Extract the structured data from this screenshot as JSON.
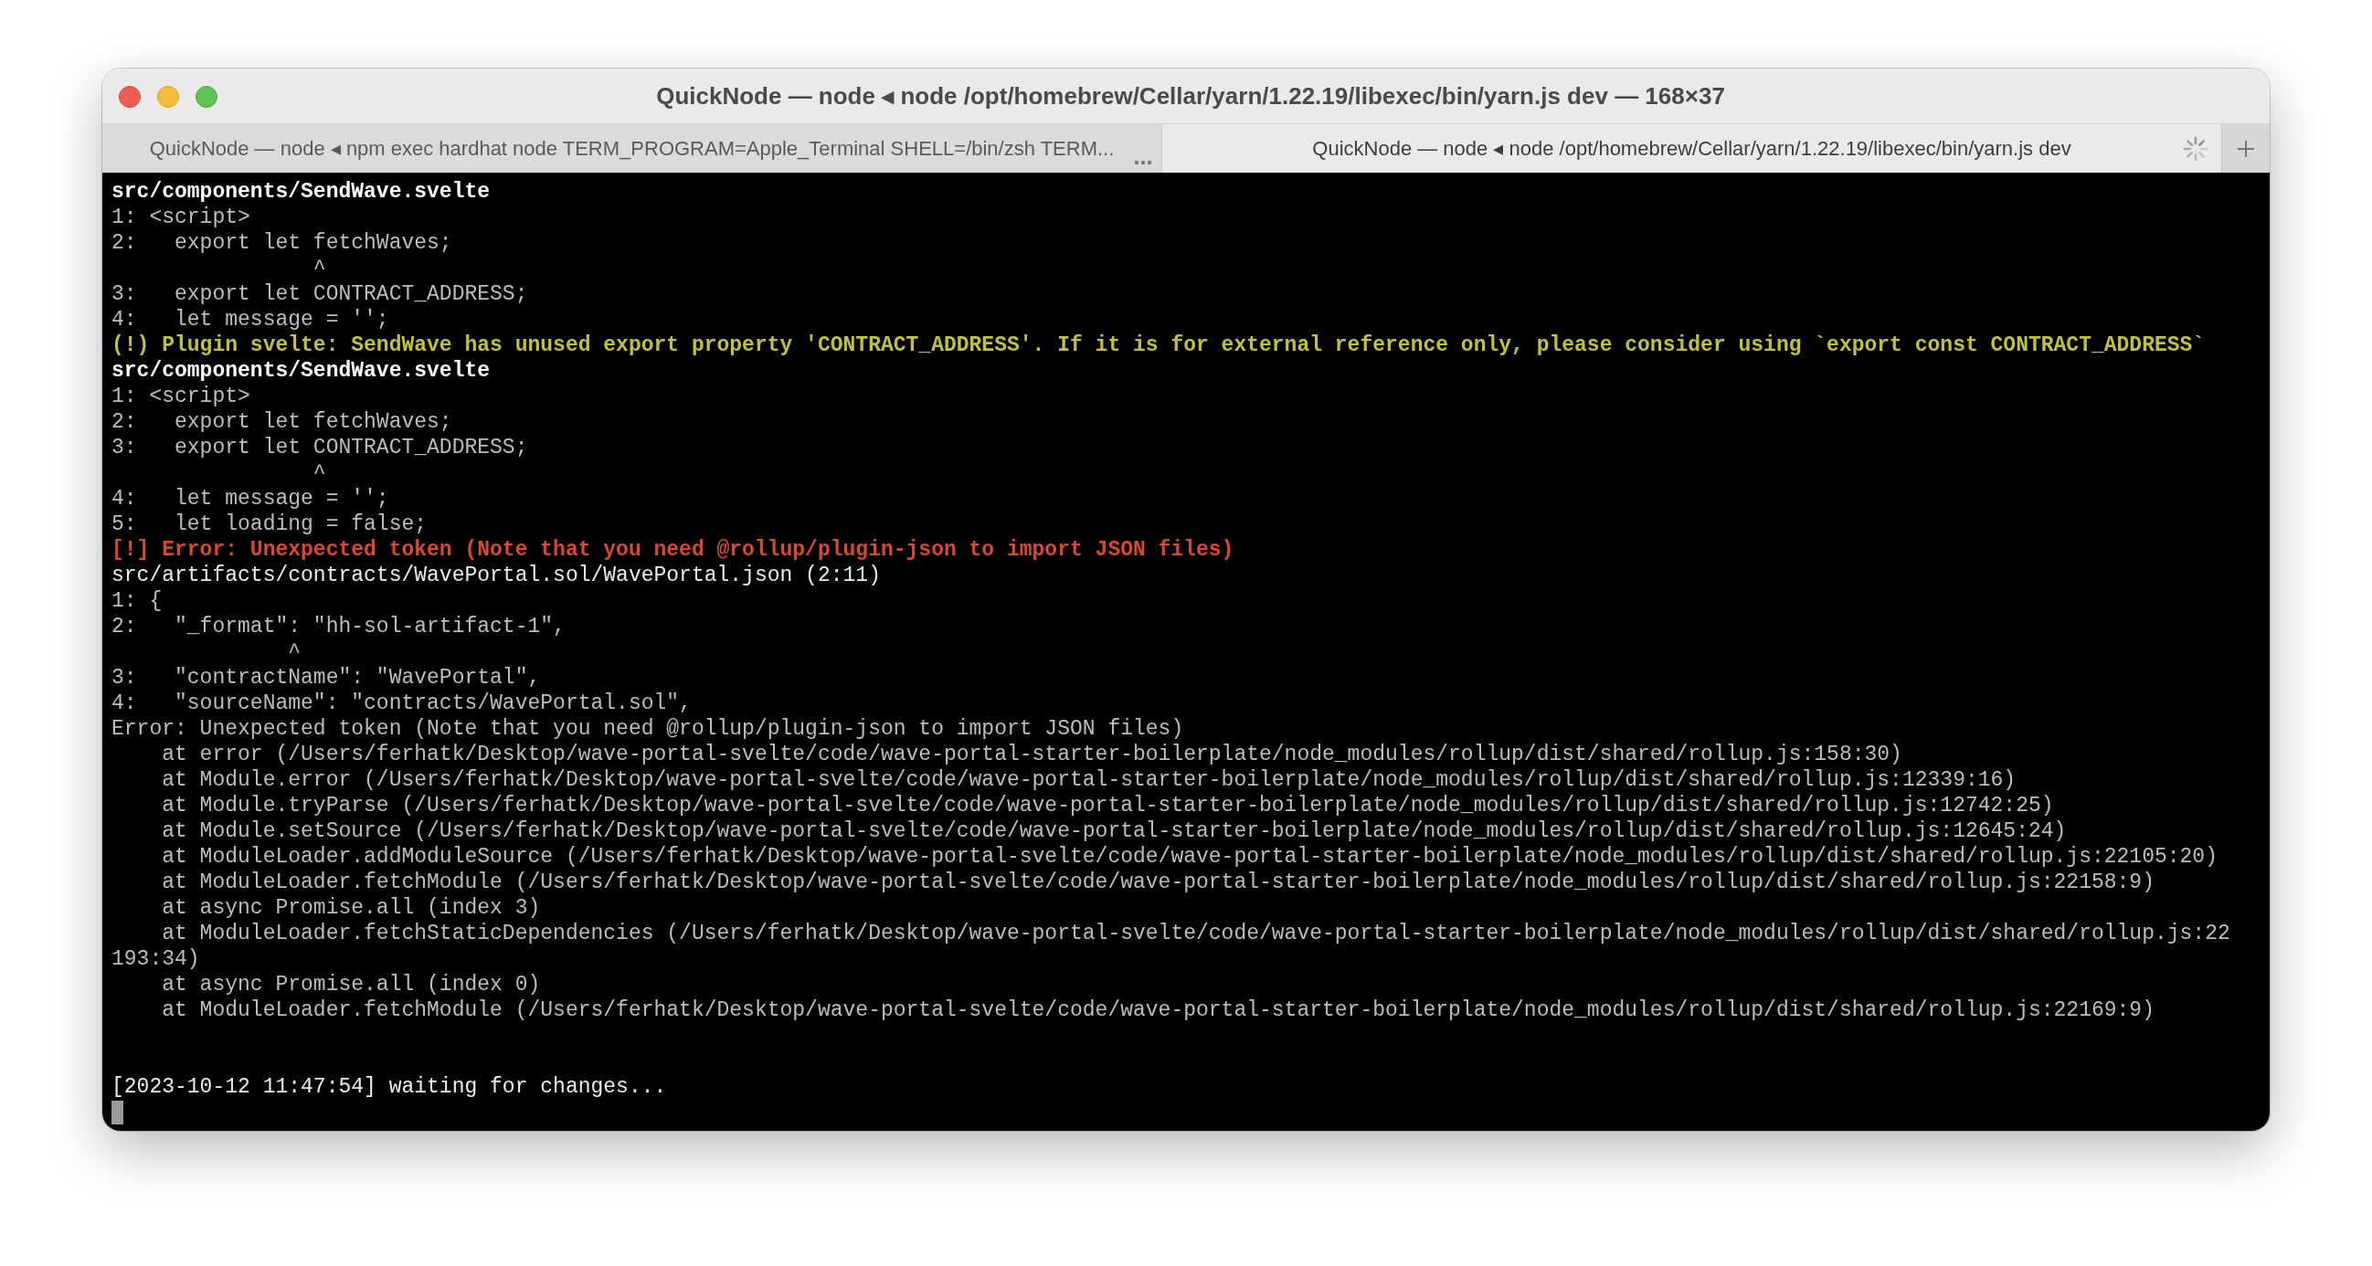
{
  "window": {
    "title": "QuickNode — node ◂ node /opt/homebrew/Cellar/yarn/1.22.19/libexec/bin/yarn.js dev — 168×37"
  },
  "tabs": [
    {
      "label": "QuickNode — node ◂ npm exec hardhat node TERM_PROGRAM=Apple_Terminal SHELL=/bin/zsh TERM...",
      "selected": false,
      "busy": false
    },
    {
      "label": "QuickNode — node ◂ node /opt/homebrew/Cellar/yarn/1.22.19/libexec/bin/yarn.js dev",
      "selected": true,
      "busy": true
    }
  ],
  "terminal": {
    "lines": [
      {
        "kind": "header",
        "text": "src/components/SendWave.svelte"
      },
      {
        "kind": "code",
        "text": "1: <script>"
      },
      {
        "kind": "code",
        "text": "2:   export let fetchWaves;"
      },
      {
        "kind": "caret",
        "text": "                ^"
      },
      {
        "kind": "code",
        "text": "3:   export let CONTRACT_ADDRESS;"
      },
      {
        "kind": "code",
        "text": "4:   let message = '';"
      },
      {
        "kind": "warning",
        "text": "(!) Plugin svelte: SendWave has unused export property 'CONTRACT_ADDRESS'. If it is for external reference only, please consider using `export const CONTRACT_ADDRESS`"
      },
      {
        "kind": "header",
        "text": "src/components/SendWave.svelte"
      },
      {
        "kind": "code",
        "text": "1: <script>"
      },
      {
        "kind": "code",
        "text": "2:   export let fetchWaves;"
      },
      {
        "kind": "code",
        "text": "3:   export let CONTRACT_ADDRESS;"
      },
      {
        "kind": "caret",
        "text": "                ^"
      },
      {
        "kind": "code",
        "text": "4:   let message = '';"
      },
      {
        "kind": "code",
        "text": "5:   let loading = false;"
      },
      {
        "kind": "error",
        "text": "[!] Error: Unexpected token (Note that you need @rollup/plugin-json to import JSON files)"
      },
      {
        "kind": "plain",
        "text": "src/artifacts/contracts/WavePortal.sol/WavePortal.json (2:11)"
      },
      {
        "kind": "code",
        "text": "1: {"
      },
      {
        "kind": "code",
        "text": "2:   \"_format\": \"hh-sol-artifact-1\","
      },
      {
        "kind": "caret",
        "text": "              ^"
      },
      {
        "kind": "code",
        "text": "3:   \"contractName\": \"WavePortal\","
      },
      {
        "kind": "code",
        "text": "4:   \"sourceName\": \"contracts/WavePortal.sol\","
      },
      {
        "kind": "code",
        "text": "Error: Unexpected token (Note that you need @rollup/plugin-json to import JSON files)"
      },
      {
        "kind": "code",
        "text": "    at error (/Users/ferhatk/Desktop/wave-portal-svelte/code/wave-portal-starter-boilerplate/node_modules/rollup/dist/shared/rollup.js:158:30)"
      },
      {
        "kind": "code",
        "text": "    at Module.error (/Users/ferhatk/Desktop/wave-portal-svelte/code/wave-portal-starter-boilerplate/node_modules/rollup/dist/shared/rollup.js:12339:16)"
      },
      {
        "kind": "code",
        "text": "    at Module.tryParse (/Users/ferhatk/Desktop/wave-portal-svelte/code/wave-portal-starter-boilerplate/node_modules/rollup/dist/shared/rollup.js:12742:25)"
      },
      {
        "kind": "code",
        "text": "    at Module.setSource (/Users/ferhatk/Desktop/wave-portal-svelte/code/wave-portal-starter-boilerplate/node_modules/rollup/dist/shared/rollup.js:12645:24)"
      },
      {
        "kind": "code",
        "text": "    at ModuleLoader.addModuleSource (/Users/ferhatk/Desktop/wave-portal-svelte/code/wave-portal-starter-boilerplate/node_modules/rollup/dist/shared/rollup.js:22105:20)"
      },
      {
        "kind": "code",
        "text": "    at ModuleLoader.fetchModule (/Users/ferhatk/Desktop/wave-portal-svelte/code/wave-portal-starter-boilerplate/node_modules/rollup/dist/shared/rollup.js:22158:9)"
      },
      {
        "kind": "code",
        "text": "    at async Promise.all (index 3)"
      },
      {
        "kind": "code",
        "text": "    at ModuleLoader.fetchStaticDependencies (/Users/ferhatk/Desktop/wave-portal-svelte/code/wave-portal-starter-boilerplate/node_modules/rollup/dist/shared/rollup.js:22"
      },
      {
        "kind": "code",
        "text": "193:34)"
      },
      {
        "kind": "code",
        "text": "    at async Promise.all (index 0)"
      },
      {
        "kind": "code",
        "text": "    at ModuleLoader.fetchModule (/Users/ferhatk/Desktop/wave-portal-svelte/code/wave-portal-starter-boilerplate/node_modules/rollup/dist/shared/rollup.js:22169:9)"
      },
      {
        "kind": "blank"
      },
      {
        "kind": "blank"
      },
      {
        "kind": "status",
        "text": "[2023-10-12 11:47:54] waiting for changes..."
      },
      {
        "kind": "cursor"
      }
    ]
  }
}
